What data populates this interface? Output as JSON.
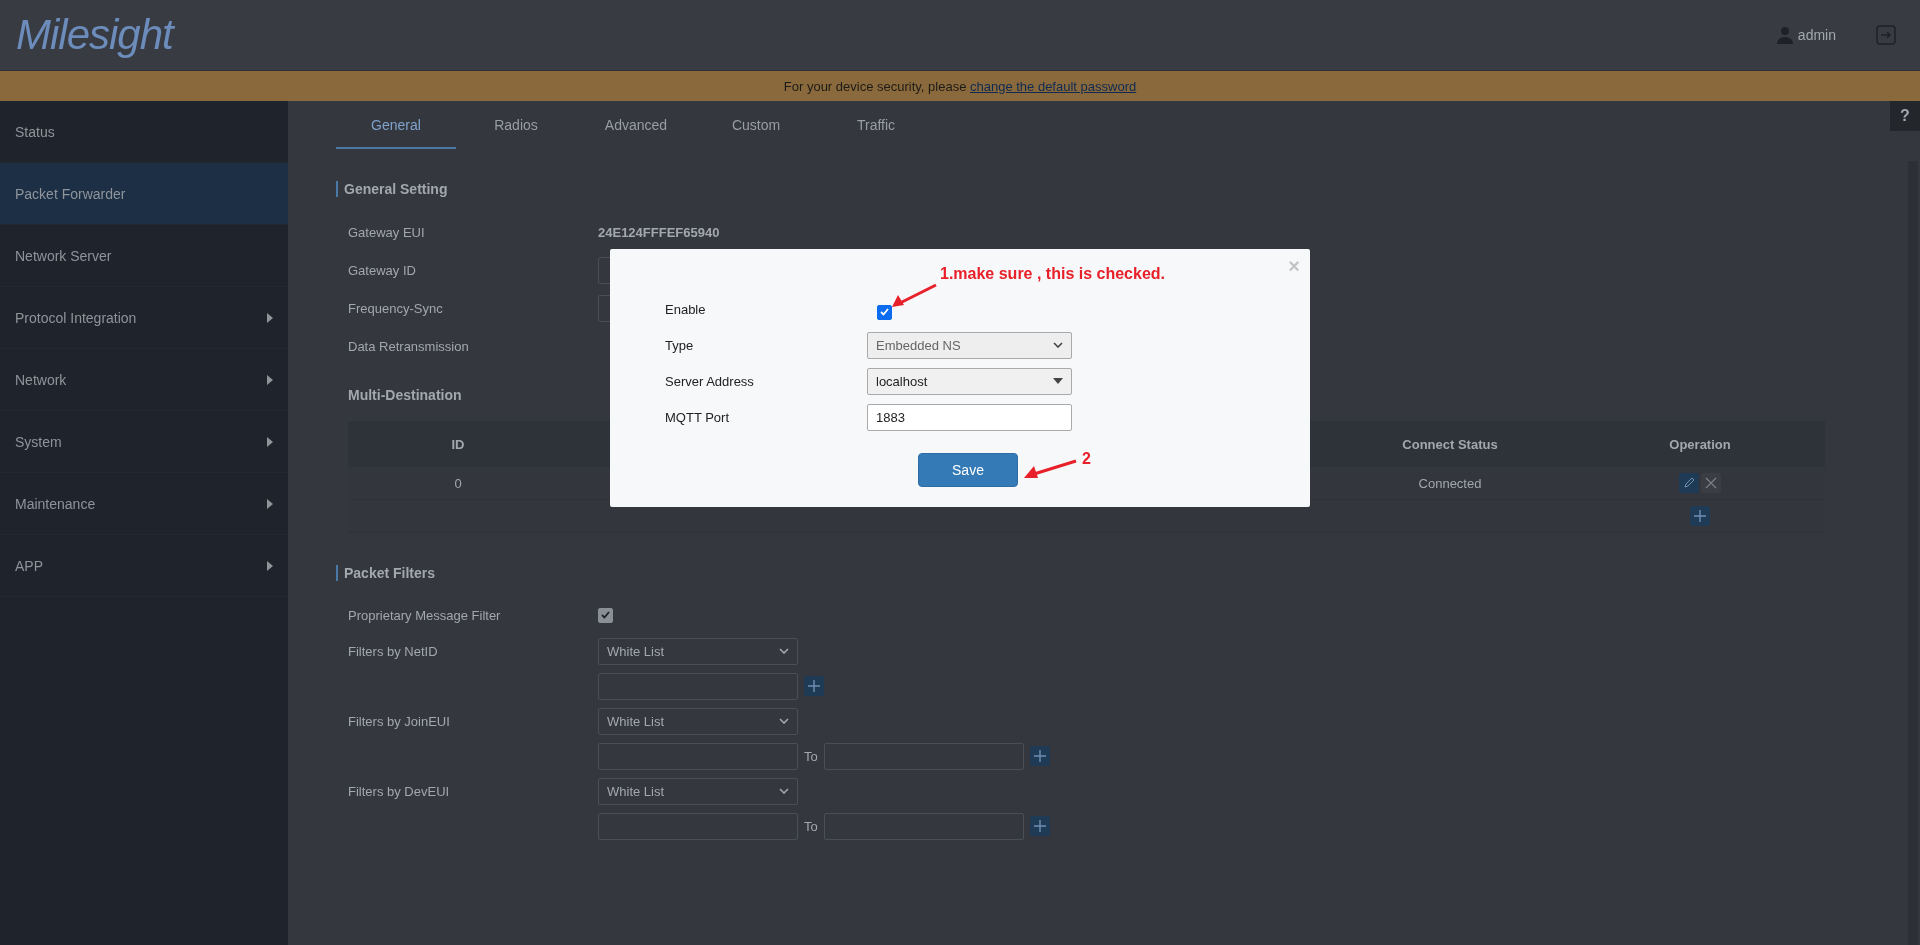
{
  "header": {
    "logo": "Milesight",
    "user": "admin"
  },
  "banner": {
    "text": "For your device security, please ",
    "link": "change the default password"
  },
  "sidebar": {
    "items": [
      {
        "label": "Status",
        "selected": false,
        "submenu": false
      },
      {
        "label": "Packet Forwarder",
        "selected": true,
        "submenu": false
      },
      {
        "label": "Network Server",
        "selected": false,
        "submenu": false
      },
      {
        "label": "Protocol Integration",
        "selected": false,
        "submenu": true
      },
      {
        "label": "Network",
        "selected": false,
        "submenu": true
      },
      {
        "label": "System",
        "selected": false,
        "submenu": true
      },
      {
        "label": "Maintenance",
        "selected": false,
        "submenu": true
      },
      {
        "label": "APP",
        "selected": false,
        "submenu": true
      }
    ]
  },
  "help": "?",
  "tabs": [
    {
      "label": "General",
      "selected": true
    },
    {
      "label": "Radios",
      "selected": false
    },
    {
      "label": "Advanced",
      "selected": false
    },
    {
      "label": "Custom",
      "selected": false
    },
    {
      "label": "Traffic",
      "selected": false
    }
  ],
  "general_setting": {
    "title": "General Setting",
    "rows": [
      {
        "kind": "text",
        "label": "Gateway EUI",
        "value": "24E124FFFEF65940"
      },
      {
        "kind": "input",
        "label": "Gateway ID"
      },
      {
        "kind": "input",
        "label": "Frequency-Sync"
      },
      {
        "kind": "label",
        "label": "Data Retransmission"
      }
    ]
  },
  "multi_destination": {
    "title": "Multi-Destination",
    "columns": [
      "ID",
      "Connect Status",
      "Operation"
    ],
    "rows": [
      {
        "id": "0",
        "status": "Connected"
      }
    ]
  },
  "packet_filters": {
    "title": "Packet Filters",
    "rows": [
      {
        "kind": "checkbox",
        "label": "Proprietary Message Filter",
        "checked": true
      },
      {
        "kind": "select",
        "label": "Filters by NetID",
        "value": "White List"
      },
      {
        "kind": "single",
        "label": ""
      },
      {
        "kind": "select",
        "label": "Filters by JoinEUI",
        "value": "White List"
      },
      {
        "kind": "range",
        "label": "",
        "to": "To"
      },
      {
        "kind": "select",
        "label": "Filters by DevEUI",
        "value": "White List"
      },
      {
        "kind": "range",
        "label": "",
        "to": "To"
      }
    ]
  },
  "dialog": {
    "close": "×",
    "fields": [
      {
        "kind": "checkbox",
        "label": "Enable",
        "checked": true
      },
      {
        "kind": "select",
        "label": "Type",
        "value": "Embedded NS",
        "disabled": true
      },
      {
        "kind": "select",
        "label": "Server Address",
        "value": "localhost",
        "disabled": false
      },
      {
        "kind": "input",
        "label": "MQTT Port",
        "value": "1883"
      }
    ],
    "save": "Save"
  },
  "annotations": [
    {
      "text": "1.make sure , this is checked."
    },
    {
      "text": "2"
    }
  ]
}
